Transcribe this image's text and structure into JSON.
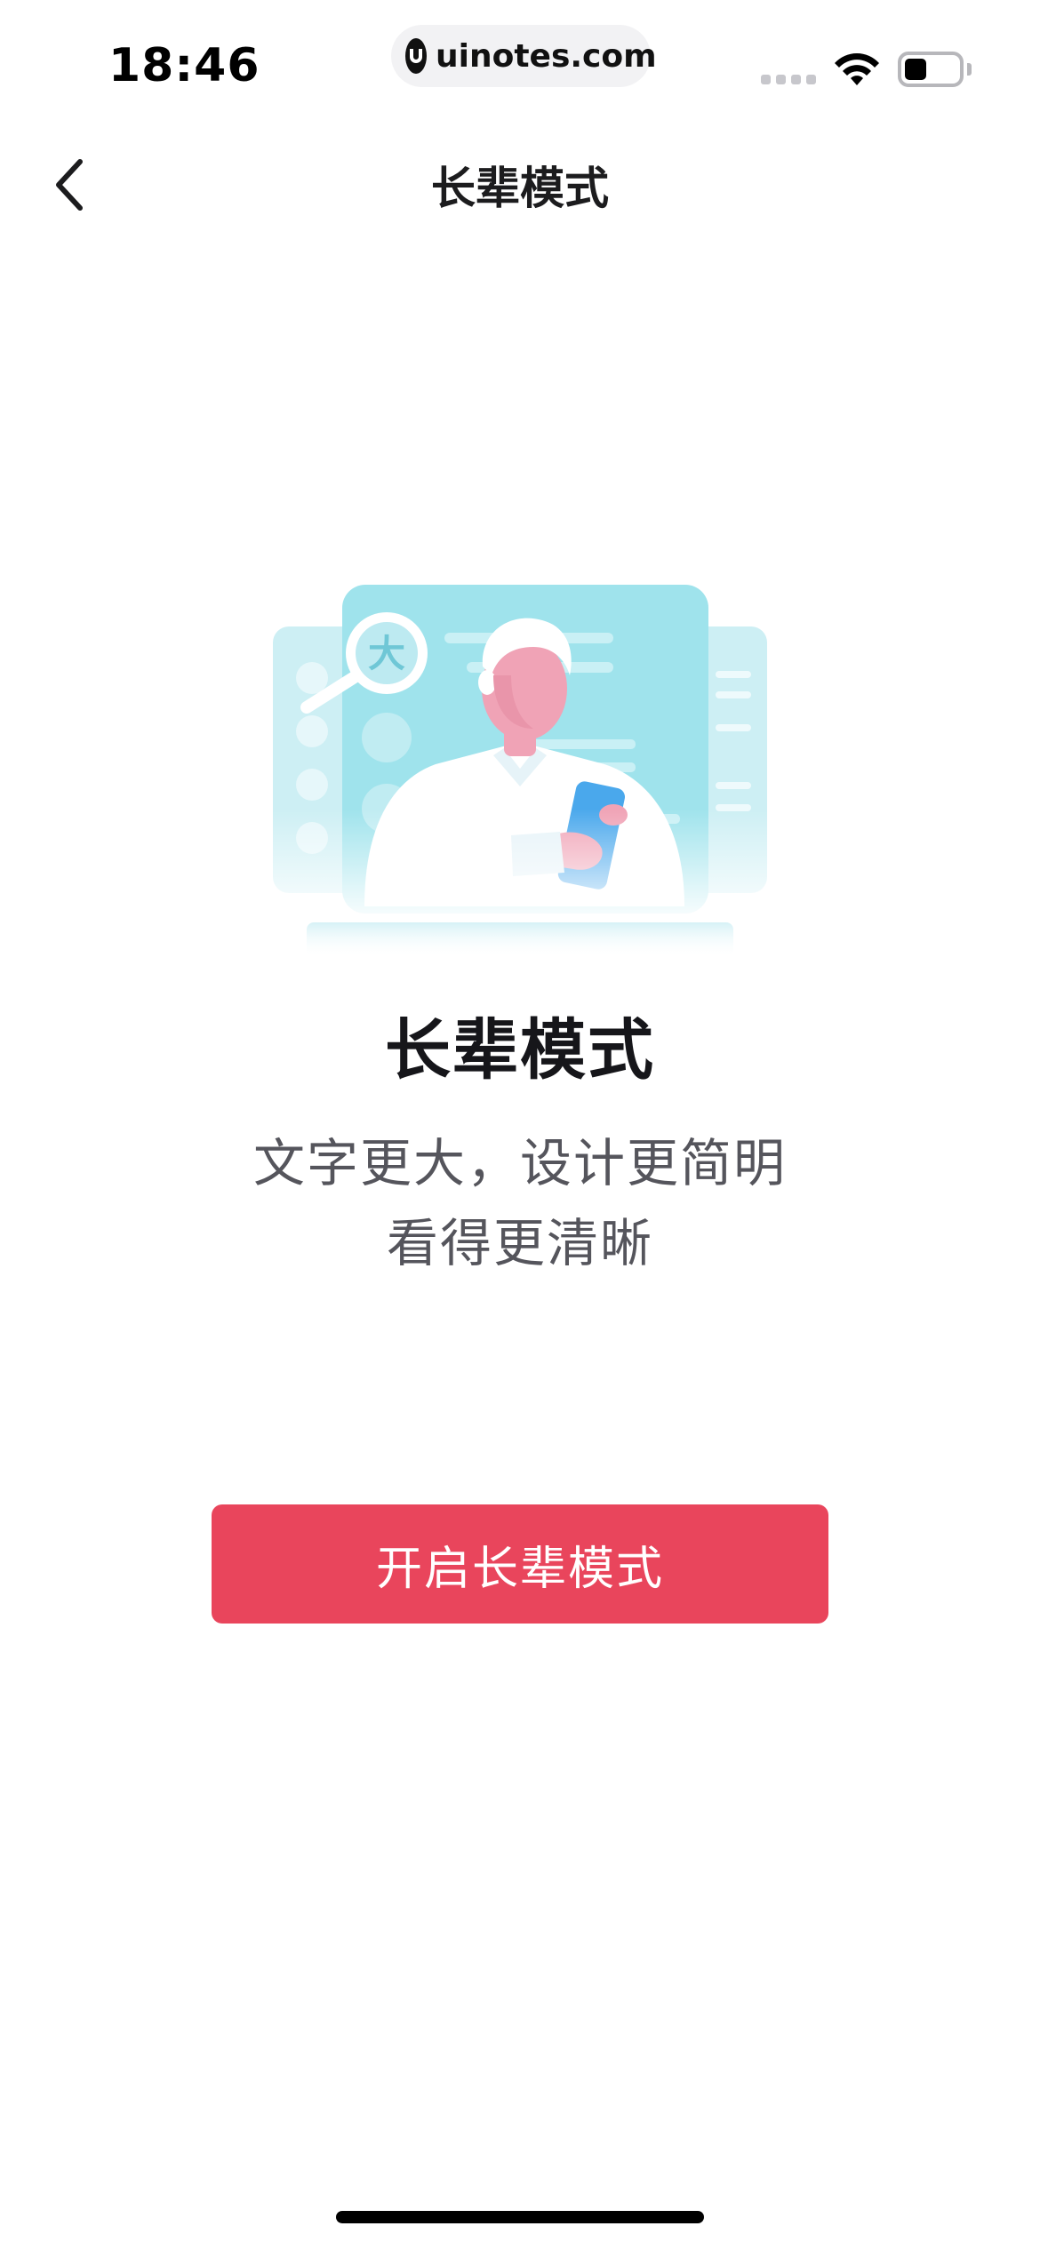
{
  "status_bar": {
    "time": "18:46",
    "url": "uinotes.com",
    "icons": [
      "site-logo-icon",
      "signal-icon",
      "wifi-icon",
      "battery-icon"
    ]
  },
  "nav": {
    "back_icon": "chevron-left-icon",
    "title": "长辈模式"
  },
  "illustration": {
    "magnifier_text": "大",
    "colors": {
      "panel": "#9fe3ec",
      "panel_light": "#cdeff4",
      "skin": "#f0a3b6",
      "phone": "#4aa8ec"
    }
  },
  "content": {
    "headline": "长辈模式",
    "description_lines": [
      "文字更大，设计更简明",
      "看得更清晰"
    ]
  },
  "action": {
    "button_label": "开启长辈模式",
    "color": "#e9455c"
  }
}
